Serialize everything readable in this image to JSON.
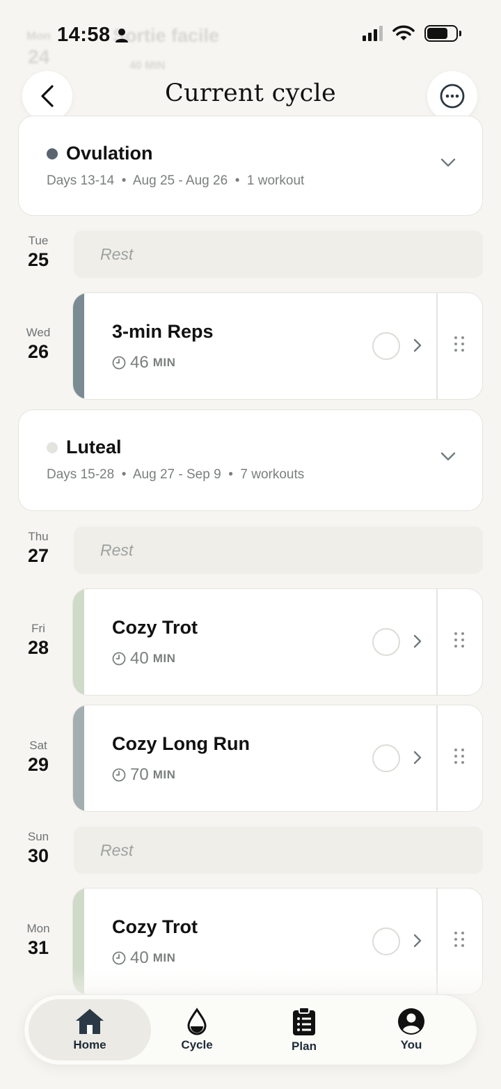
{
  "status_bar": {
    "time": "14:58"
  },
  "background_ghost": {
    "day": "Mon",
    "date": "24",
    "title": "Sortie facile",
    "duration": "40 MIN"
  },
  "header": {
    "title": "Current cycle"
  },
  "phases": [
    {
      "name": "Ovulation",
      "meta": "Days 13-14  •  Aug 25 - Aug 26  •  1 workout",
      "dot_color": "#5a6570"
    },
    {
      "name": "Luteal",
      "meta": "Days 15-28  •  Aug 27 - Sep 9  •  7 workouts",
      "dot_color": "#e4e3de"
    }
  ],
  "days": [
    {
      "dow": "Tue",
      "num": "25",
      "rest_label": "Rest"
    },
    {
      "dow": "Wed",
      "num": "26",
      "workout": {
        "title": "3-min Reps",
        "duration": "46",
        "unit": "MIN",
        "stripe": "#7b8b93"
      }
    },
    {
      "dow": "Thu",
      "num": "27",
      "rest_label": "Rest"
    },
    {
      "dow": "Fri",
      "num": "28",
      "workout": {
        "title": "Cozy Trot",
        "duration": "40",
        "unit": "MIN",
        "stripe": "#cfdac8"
      }
    },
    {
      "dow": "Sat",
      "num": "29",
      "workout": {
        "title": "Cozy Long Run",
        "duration": "70",
        "unit": "MIN",
        "stripe": "#a3aeb1"
      }
    },
    {
      "dow": "Sun",
      "num": "30",
      "rest_label": "Rest"
    },
    {
      "dow": "Mon",
      "num": "31",
      "workout": {
        "title": "Cozy Trot",
        "duration": "40",
        "unit": "MIN",
        "stripe": "#cfdac8"
      }
    }
  ],
  "nav": [
    {
      "label": "Home",
      "icon": "home-icon",
      "active": true
    },
    {
      "label": "Cycle",
      "icon": "drop-icon"
    },
    {
      "label": "Plan",
      "icon": "clipboard-icon"
    },
    {
      "label": "You",
      "icon": "user-icon"
    }
  ]
}
